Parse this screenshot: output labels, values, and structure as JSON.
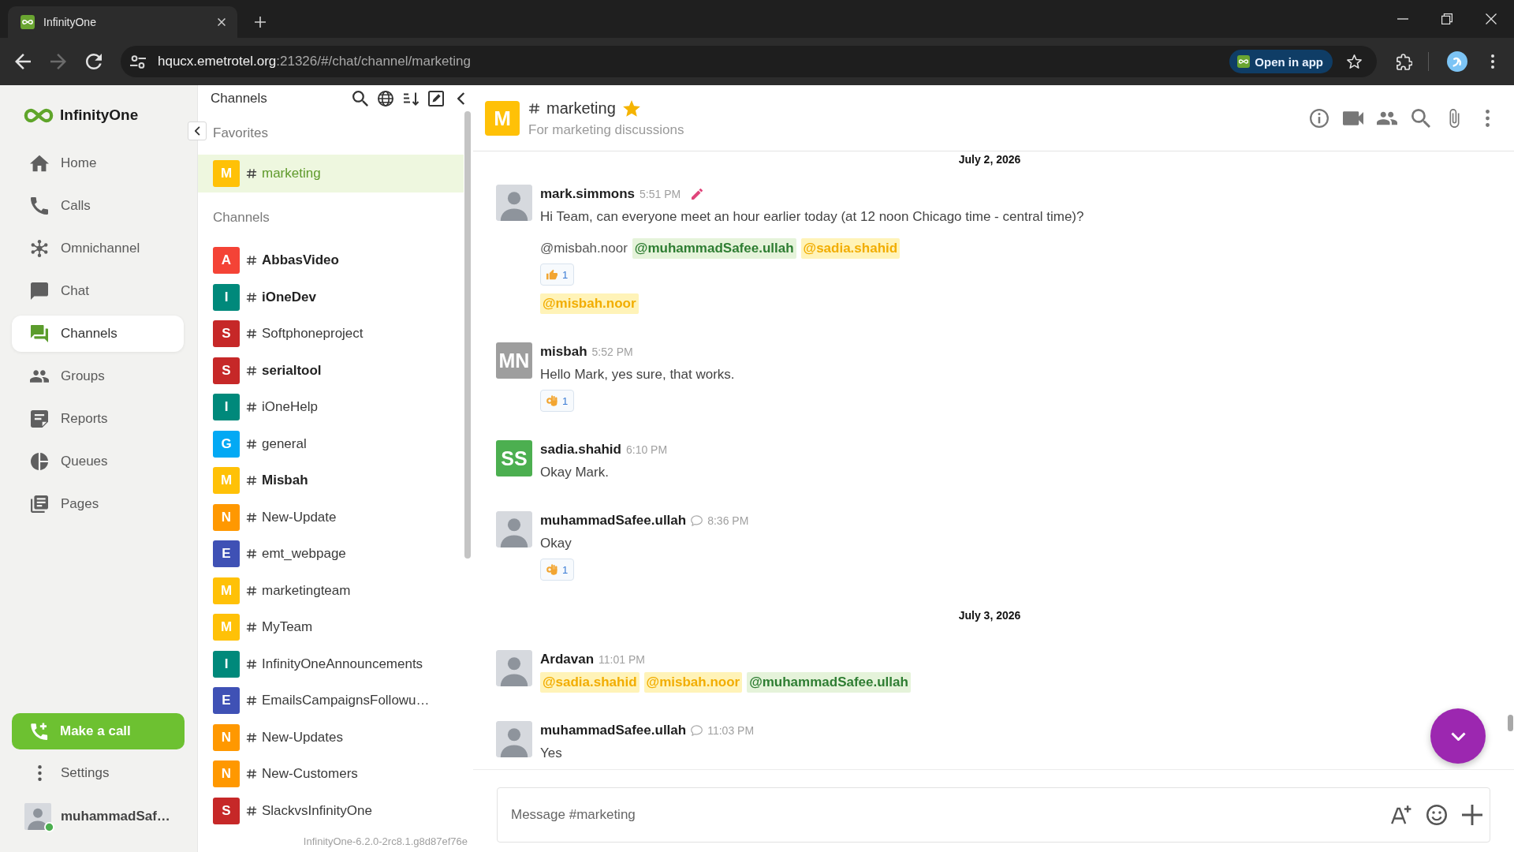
{
  "browser": {
    "tab_title": "InfinityOne",
    "url": {
      "host": "hqucx.emetrotel.org",
      "path": ":21326/#/chat/channel/marketing"
    },
    "forward_disabled": true,
    "open_in_app": "Open in app"
  },
  "nav": {
    "brand": "InfinityOne",
    "items": [
      {
        "label": "Home",
        "selected": false
      },
      {
        "label": "Calls",
        "selected": false
      },
      {
        "label": "Omnichannel",
        "selected": false
      },
      {
        "label": "Chat",
        "selected": false
      },
      {
        "label": "Channels",
        "selected": true
      },
      {
        "label": "Groups",
        "selected": false
      },
      {
        "label": "Reports",
        "selected": false
      },
      {
        "label": "Queues",
        "selected": false
      },
      {
        "label": "Pages",
        "selected": false
      }
    ],
    "call_button": "Make a call",
    "settings": "Settings",
    "user": {
      "name": "muhammadSaf…",
      "online": true
    }
  },
  "channels_panel": {
    "title": "Channels",
    "favorites_label": "Favorites",
    "favorites": [
      {
        "letter": "M",
        "name": "marketing",
        "color": "#ffc107",
        "selected": true,
        "unread": false
      }
    ],
    "channels_label": "Channels",
    "channels": [
      {
        "letter": "A",
        "name": "AbbasVideo",
        "color": "#f44336",
        "selected": false,
        "unread": true
      },
      {
        "letter": "I",
        "name": "iOneDev",
        "color": "#00897b",
        "selected": false,
        "unread": true
      },
      {
        "letter": "S",
        "name": "Softphoneproject",
        "color": "#c62828",
        "selected": false,
        "unread": false
      },
      {
        "letter": "S",
        "name": "serialtool",
        "color": "#c62828",
        "selected": false,
        "unread": true
      },
      {
        "letter": "I",
        "name": "iOneHelp",
        "color": "#00897b",
        "selected": false,
        "unread": false
      },
      {
        "letter": "G",
        "name": "general",
        "color": "#03a9f4",
        "selected": false,
        "unread": false
      },
      {
        "letter": "M",
        "name": "Misbah",
        "color": "#ffc107",
        "selected": false,
        "unread": true
      },
      {
        "letter": "N",
        "name": "New-Update",
        "color": "#ff9800",
        "selected": false,
        "unread": false
      },
      {
        "letter": "E",
        "name": "emt_webpage",
        "color": "#3f51b5",
        "selected": false,
        "unread": false
      },
      {
        "letter": "M",
        "name": "marketingteam",
        "color": "#ffc107",
        "selected": false,
        "unread": false
      },
      {
        "letter": "M",
        "name": "MyTeam",
        "color": "#ffc107",
        "selected": false,
        "unread": false
      },
      {
        "letter": "I",
        "name": "InfinityOneAnnouncements",
        "color": "#00897b",
        "selected": false,
        "unread": false
      },
      {
        "letter": "E",
        "name": "EmailsCampaignsFollowu…",
        "color": "#3f51b5",
        "selected": false,
        "unread": false
      },
      {
        "letter": "N",
        "name": "New-Updates",
        "color": "#ff9800",
        "selected": false,
        "unread": false
      },
      {
        "letter": "N",
        "name": "New-Customers",
        "color": "#ff9800",
        "selected": false,
        "unread": false
      },
      {
        "letter": "S",
        "name": "SlackvsInfinityOne",
        "color": "#c62828",
        "selected": false,
        "unread": false
      }
    ],
    "version": "InfinityOne-6.2.0-2rc8.1.g8d87ef76e"
  },
  "chat": {
    "room": {
      "letter": "M",
      "color": "#ffc107",
      "name": "marketing",
      "favorite": true,
      "topic": "For marketing discussions"
    },
    "timeline": [
      {
        "kind": "date",
        "text": "July 2, 2026"
      },
      {
        "kind": "message",
        "author": "mark.simmons",
        "time": "5:51 PM",
        "edited": true,
        "reply": false,
        "avatar": {
          "kind": "photo"
        },
        "body": [
          {
            "kind": "text",
            "text": "Hi Team, can everyone meet an hour earlier today (at 12 noon Chicago time - central time)?"
          },
          {
            "kind": "mentions",
            "items": [
              {
                "text": "@misbah.noor",
                "kind": "plain"
              },
              {
                "text": "@muhammadSafee.ullah",
                "kind": "self"
              },
              {
                "text": "@sadia.shahid",
                "kind": "user"
              }
            ]
          },
          {
            "kind": "reactions",
            "items": [
              {
                "kind": "thumbs_up",
                "count": "1"
              }
            ]
          },
          {
            "kind": "mentions",
            "items": [
              {
                "text": "@misbah.noor",
                "kind": "user"
              }
            ]
          }
        ]
      },
      {
        "kind": "message",
        "author": "misbah",
        "time": "5:52 PM",
        "edited": false,
        "reply": false,
        "avatar": {
          "kind": "initials",
          "text": "MN",
          "color": "#9e9e9e"
        },
        "body": [
          {
            "kind": "text",
            "text": "Hello Mark, yes sure, that works."
          },
          {
            "kind": "reactions",
            "items": [
              {
                "kind": "ok_hand",
                "count": "1"
              }
            ]
          }
        ]
      },
      {
        "kind": "message",
        "author": "sadia.shahid",
        "time": "6:10 PM",
        "edited": false,
        "reply": false,
        "avatar": {
          "kind": "initials",
          "text": "SS",
          "color": "#4caf50"
        },
        "body": [
          {
            "kind": "text",
            "text": "Okay Mark."
          }
        ]
      },
      {
        "kind": "message",
        "author": "muhammadSafee.ullah",
        "time": "8:36 PM",
        "edited": false,
        "reply": true,
        "avatar": {
          "kind": "photo"
        },
        "body": [
          {
            "kind": "text",
            "text": "Okay"
          },
          {
            "kind": "reactions",
            "items": [
              {
                "kind": "ok_hand",
                "count": "1"
              }
            ]
          }
        ]
      },
      {
        "kind": "date",
        "text": "July 3, 2026"
      },
      {
        "kind": "message",
        "author": "Ardavan",
        "time": "11:01 PM",
        "edited": false,
        "reply": false,
        "avatar": {
          "kind": "photo"
        },
        "body": [
          {
            "kind": "mentions",
            "items": [
              {
                "text": "@sadia.shahid",
                "kind": "user"
              },
              {
                "text": "@misbah.noor",
                "kind": "user"
              },
              {
                "text": "@muhammadSafee.ullah",
                "kind": "self"
              }
            ]
          }
        ]
      },
      {
        "kind": "message",
        "author": "muhammadSafee.ullah",
        "time": "11:03 PM",
        "edited": false,
        "reply": true,
        "avatar": {
          "kind": "photo"
        },
        "body": [
          {
            "kind": "text",
            "text": "Yes"
          }
        ]
      }
    ],
    "composer": {
      "placeholder": "Message #marketing"
    }
  }
}
